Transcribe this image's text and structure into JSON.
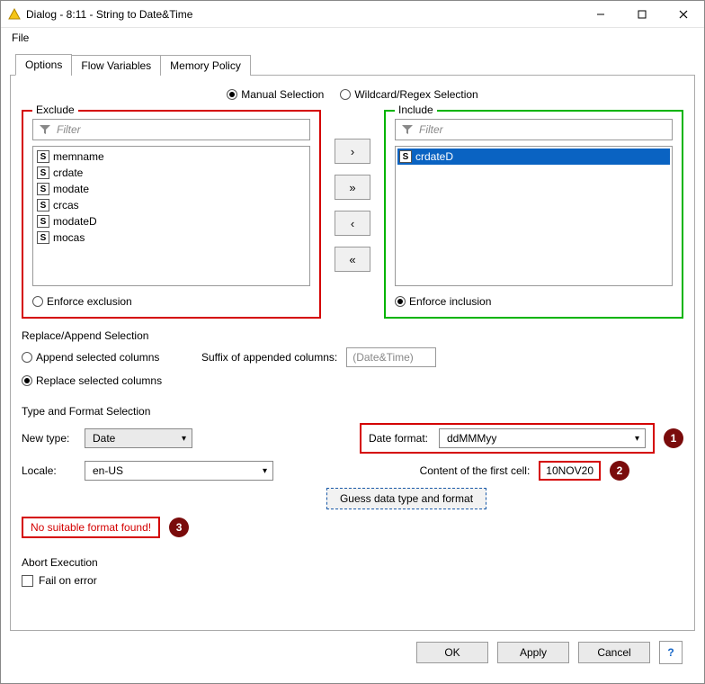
{
  "window": {
    "title": "Dialog - 8:11 - String to Date&Time"
  },
  "menu": {
    "file": "File"
  },
  "tabs": [
    {
      "label": "Options",
      "active": true
    },
    {
      "label": "Flow Variables",
      "active": false
    },
    {
      "label": "Memory Policy",
      "active": false
    }
  ],
  "selection_mode": {
    "manual": "Manual Selection",
    "wildcard": "Wildcard/Regex Selection",
    "value": "manual"
  },
  "exclude": {
    "legend": "Exclude",
    "filter_placeholder": "Filter",
    "items": [
      "memname",
      "crdate",
      "modate",
      "crcas",
      "modateD",
      "mocas"
    ],
    "enforce_label": "Enforce exclusion",
    "enforce_selected": false
  },
  "include": {
    "legend": "Include",
    "filter_placeholder": "Filter",
    "items": [
      "crdateD"
    ],
    "selected_index": 0,
    "enforce_label": "Enforce inclusion",
    "enforce_selected": true
  },
  "move_buttons": {
    "right": "›",
    "all_right": "»",
    "left": "‹",
    "all_left": "«"
  },
  "replace_append": {
    "legend": "Replace/Append Selection",
    "append_label": "Append selected columns",
    "replace_label": "Replace selected columns",
    "value": "replace",
    "suffix_label": "Suffix of appended columns:",
    "suffix_placeholder": "(Date&Time)"
  },
  "type_format": {
    "legend": "Type and Format Selection",
    "new_type_label": "New type:",
    "new_type_value": "Date",
    "date_format_label": "Date format:",
    "date_format_value": "ddMMMyy",
    "locale_label": "Locale:",
    "locale_value": "en-US",
    "first_cell_label": "Content of the first cell:",
    "first_cell_value": "10NOV20",
    "guess_button": "Guess data type and format",
    "error_text": "No suitable format found!"
  },
  "abort": {
    "legend": "Abort Execution",
    "fail_label": "Fail on error",
    "fail_checked": false
  },
  "footer": {
    "ok": "OK",
    "apply": "Apply",
    "cancel": "Cancel"
  },
  "annotations": {
    "a1": "1",
    "a2": "2",
    "a3": "3"
  },
  "type_glyph": "S"
}
